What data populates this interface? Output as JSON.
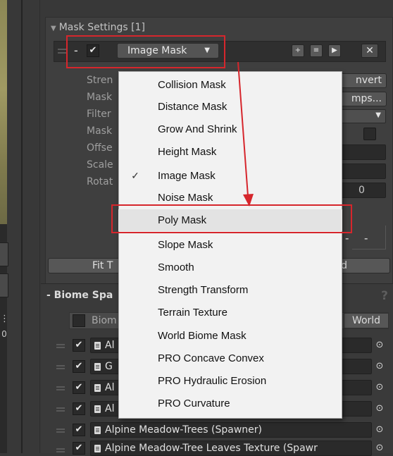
{
  "left": {
    "glyph": "⋮",
    "number": "0"
  },
  "mask_panel": {
    "title": "Mask Settings [1]",
    "row": {
      "remove": "-",
      "check": "✔",
      "type_label": "Image Mask",
      "dropdown_arrow": "▼",
      "close": "✕"
    },
    "props": [
      "Stren",
      "Mask",
      "Filter",
      "Mask",
      "Offse",
      "Scale",
      "Rotat"
    ],
    "invert_label": "nvert",
    "maps_label": "mps...",
    "rotation_value": "0",
    "fit_left": "Fit T",
    "fit_right": "d",
    "dash_a": "-",
    "dash_b": "-"
  },
  "biome_panel": {
    "title": "- Biome Spa",
    "help": "?",
    "header_label": "Biom",
    "world_label": "World",
    "rows": [
      {
        "check": "✔",
        "name": "Al",
        "target": "⊙"
      },
      {
        "check": "✔",
        "name": "G",
        "target": "⊙"
      },
      {
        "check": "✔",
        "name": "Al",
        "target": "⊙"
      },
      {
        "check": "✔",
        "name": "Al",
        "target": "⊙"
      },
      {
        "check": "✔",
        "name": "Alpine Meadow-Trees (Spawner)",
        "target": "⊙"
      },
      {
        "check": "✔",
        "name": "Alpine Meadow-Tree Leaves Texture (Spawr",
        "target": "⊙"
      }
    ]
  },
  "menu": {
    "items": [
      {
        "label": "Collision Mask",
        "checked": ""
      },
      {
        "label": "Distance Mask",
        "checked": ""
      },
      {
        "label": "Grow And Shrink",
        "checked": ""
      },
      {
        "label": "Height Mask",
        "checked": ""
      },
      {
        "label": "Image Mask",
        "checked": "✓"
      },
      {
        "label": "Noise Mask",
        "checked": ""
      },
      {
        "label": "Poly Mask",
        "checked": ""
      },
      {
        "label": "Slope Mask",
        "checked": ""
      },
      {
        "label": "Smooth",
        "checked": ""
      },
      {
        "label": "Strength Transform",
        "checked": ""
      },
      {
        "label": "Terrain Texture",
        "checked": ""
      },
      {
        "label": "World Biome Mask",
        "checked": ""
      },
      {
        "label": "PRO Concave Convex",
        "checked": ""
      },
      {
        "label": "PRO Hydraulic Erosion",
        "checked": ""
      },
      {
        "label": "PRO Curvature",
        "checked": ""
      }
    ]
  },
  "colors": {
    "highlight": "#d6262c",
    "panel": "#3f3f3f",
    "menu_bg": "#f2f2f2"
  }
}
